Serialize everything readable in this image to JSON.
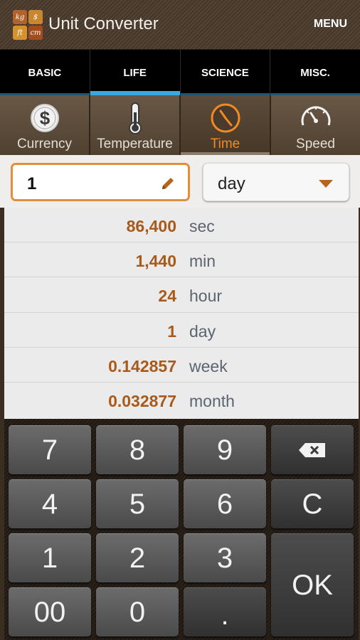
{
  "actionbar": {
    "title": "Unit Converter",
    "menu_label": "MENU",
    "icon_cells": [
      "kg",
      "$",
      "ft",
      "cm"
    ]
  },
  "categories": [
    {
      "label": "BASIC",
      "active": false
    },
    {
      "label": "LIFE",
      "active": true
    },
    {
      "label": "SCIENCE",
      "active": false
    },
    {
      "label": "MISC.",
      "active": false
    }
  ],
  "unit_types": [
    {
      "label": "Currency",
      "icon": "dollar-coin-icon",
      "active": false
    },
    {
      "label": "Temperature",
      "icon": "thermometer-icon",
      "active": false
    },
    {
      "label": "Time",
      "icon": "clock-icon",
      "active": true
    },
    {
      "label": "Speed",
      "icon": "speedometer-icon",
      "active": false
    }
  ],
  "input": {
    "value": "1",
    "unit": "day"
  },
  "results": [
    {
      "value": "86,400",
      "unit": "sec"
    },
    {
      "value": "1,440",
      "unit": "min"
    },
    {
      "value": "24",
      "unit": "hour"
    },
    {
      "value": "1",
      "unit": "day"
    },
    {
      "value": "0.142857",
      "unit": "week"
    },
    {
      "value": "0.032877",
      "unit": "month"
    }
  ],
  "keypad": {
    "k7": "7",
    "k8": "8",
    "k9": "9",
    "k4": "4",
    "k5": "5",
    "k6": "6",
    "clear": "C",
    "k1": "1",
    "k2": "2",
    "k3": "3",
    "ok": "OK",
    "k00": "00",
    "k0": "0",
    "dot": "."
  },
  "colors": {
    "accent": "#f08a24",
    "tab_indicator": "#3aa9dd",
    "result_value": "#a85a1a"
  }
}
